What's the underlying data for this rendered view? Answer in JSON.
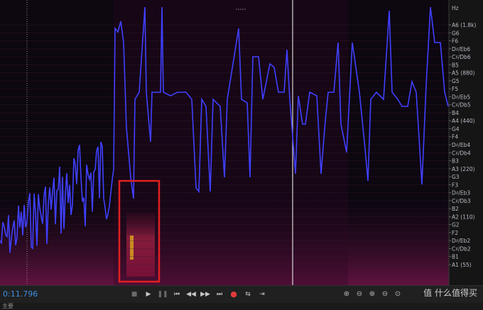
{
  "pitch_axis": {
    "unit": "Hz",
    "labels": [
      "A6 (1.8k)",
      "G6",
      "F6",
      "D♯/Eb6",
      "C♯/Db6",
      "B5",
      "A5 (880)",
      "G5",
      "F5",
      "D♯/Eb5",
      "C♯/Db5",
      "B4",
      "A4 (440)",
      "G4",
      "F4",
      "D♯/Eb4",
      "C♯/Db4",
      "B3",
      "A3 (220)",
      "G3",
      "F3",
      "D♯/Eb3",
      "C♯/Db3",
      "B2",
      "A2 (110)",
      "G2",
      "F2",
      "D♯/Eb2",
      "C♯/Db2",
      "B1",
      "A1 (55)"
    ]
  },
  "colors": {
    "pitch_line": "#4040ff",
    "highlight_box": "#e02020",
    "time_text": "#3d8fe0",
    "record": "#e23b3b"
  },
  "transport": {
    "time": "0:11.796",
    "buttons": [
      "stop",
      "play",
      "pause",
      "go-to-start",
      "rewind",
      "fast-forward",
      "go-to-end",
      "record",
      "loop",
      "skip-selection"
    ]
  },
  "zoom_buttons": [
    "zoom-in-amplitude",
    "zoom-out-amplitude",
    "zoom-in-time",
    "zoom-out-time",
    "zoom-full"
  ],
  "watermark": "值 什么值得买",
  "bottom_label": "主要"
}
